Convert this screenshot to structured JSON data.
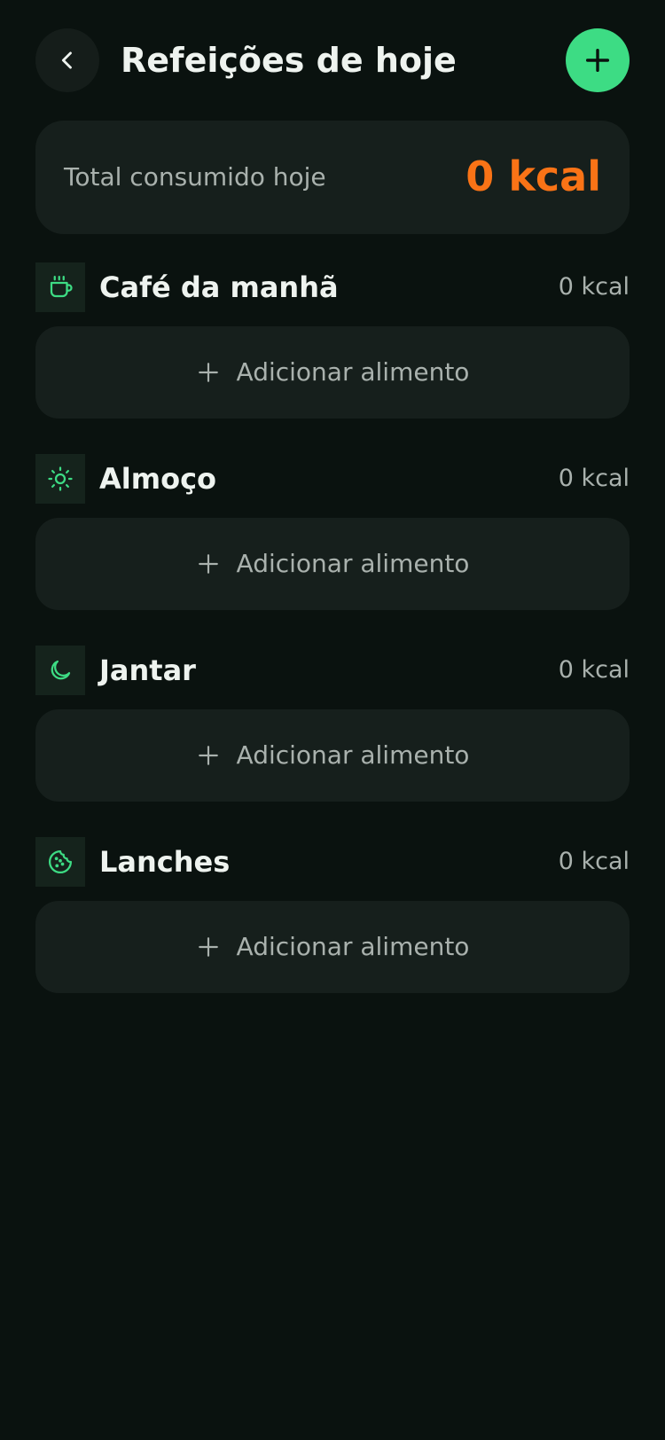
{
  "colors": {
    "background": "#0a120f",
    "card": "#161f1c",
    "accent_green": "#3ddc84",
    "accent_orange": "#f97316",
    "muted_text": "#a9b1ad"
  },
  "header": {
    "back_icon": "chevron-left-icon",
    "title": "Refeições de hoje",
    "add_icon": "plus-icon"
  },
  "summary": {
    "label": "Total consumido hoje",
    "value": "0 kcal"
  },
  "meals": [
    {
      "icon": "coffee-cup-icon",
      "name": "Café da manhã",
      "kcal": "0 kcal",
      "add_label": "Adicionar alimento"
    },
    {
      "icon": "sun-icon",
      "name": "Almoço",
      "kcal": "0 kcal",
      "add_label": "Adicionar alimento"
    },
    {
      "icon": "moon-icon",
      "name": "Jantar",
      "kcal": "0 kcal",
      "add_label": "Adicionar alimento"
    },
    {
      "icon": "cookie-icon",
      "name": "Lanches",
      "kcal": "0 kcal",
      "add_label": "Adicionar alimento"
    }
  ]
}
